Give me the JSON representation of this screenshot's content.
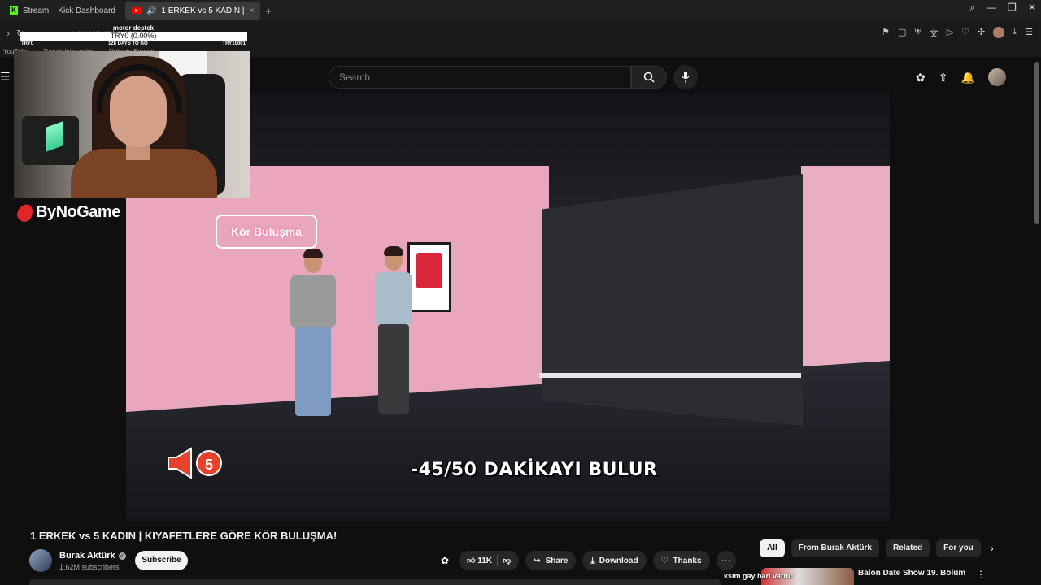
{
  "browser": {
    "tabs": [
      {
        "label": "Stream – Kick Dashboard",
        "active": false
      },
      {
        "label": "1 ERKEK vs 5 KADIN |",
        "active": true
      }
    ],
    "url": "www.youtube.com/...",
    "bookmarks": [
      "YouTube",
      "Tequst Interactive",
      "Nobody Stream"
    ]
  },
  "overlay": {
    "goal_label": "motor destek",
    "goal_bar_text": "TRY0 (0.00%)",
    "goal_left": "TRY0",
    "goal_mid": "128 DAYS TO GO",
    "goal_right": "TRY10001",
    "sponsor": "ByNoGame"
  },
  "youtube": {
    "search_placeholder": "Search",
    "video": {
      "subtitle": "-45/50 DAKİKAYI BULUR",
      "volume_badge": "5",
      "neon_sign": "Kör Buluşma"
    },
    "title": "1 ERKEK vs 5 KADIN | KIYAFETLERE GÖRE KÖR BULUŞMA!",
    "channel": {
      "name": "Burak Aktürk",
      "subscribers": "1.62M subscribers",
      "subscribe_label": "Subscribe"
    },
    "actions": {
      "likes": "11K",
      "share": "Share",
      "download": "Download",
      "thanks": "Thanks"
    },
    "chips": [
      "All",
      "From Burak Aktürk",
      "Related",
      "For you"
    ],
    "recommended": {
      "title": "Balon Date Show 19. Bölüm"
    },
    "chat_snippet": "ksım gay barı vardır"
  },
  "colors": {
    "bg": "#0f0f0f",
    "youtube_red": "#ff0000",
    "kick_green": "#53fc18",
    "sponsor_red": "#e02727"
  }
}
